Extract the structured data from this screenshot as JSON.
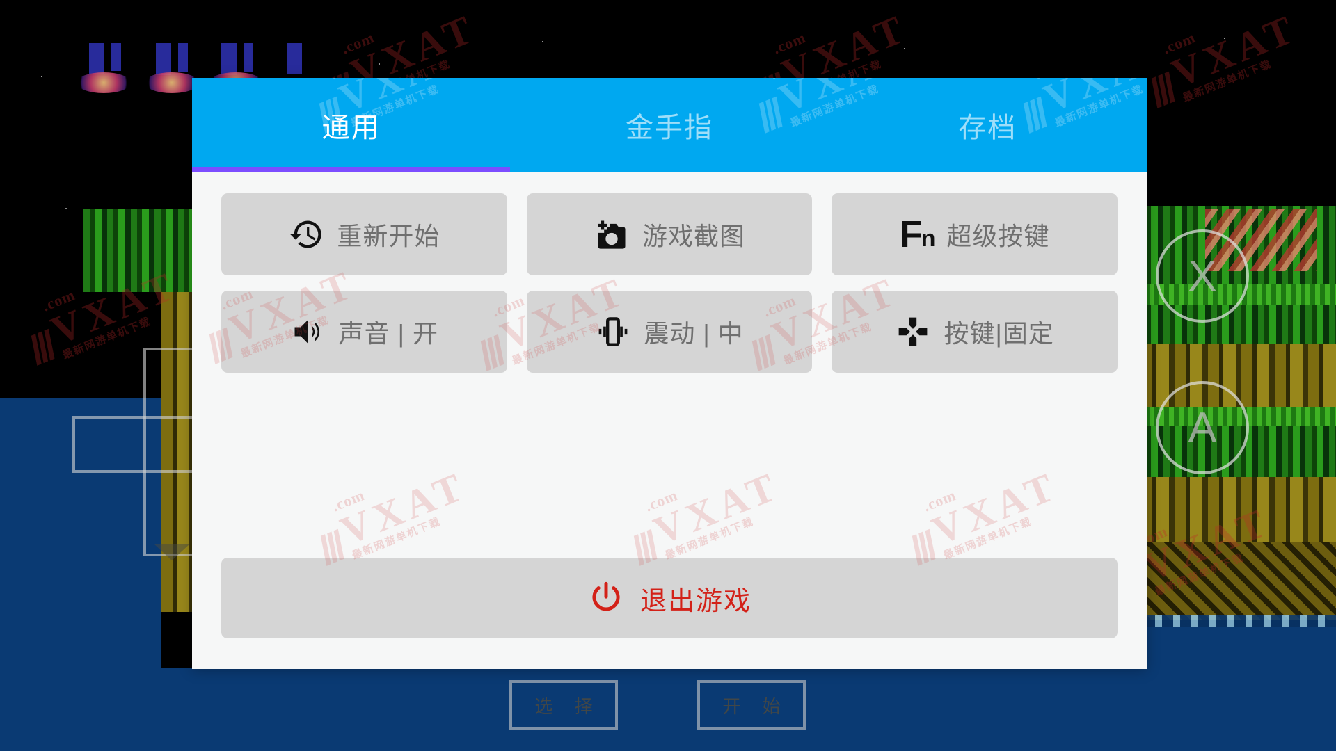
{
  "dialog": {
    "tabs": [
      {
        "id": "general",
        "label": "通用",
        "active": true
      },
      {
        "id": "cheats",
        "label": "金手指",
        "active": false
      },
      {
        "id": "saves",
        "label": "存档",
        "active": false
      }
    ],
    "options": [
      {
        "id": "restart",
        "icon": "restore-history-icon",
        "label": "重新开始"
      },
      {
        "id": "screenshot",
        "icon": "add-a-photo-icon",
        "label": "游戏截图"
      },
      {
        "id": "superkey",
        "icon": "fn-key-icon",
        "label": "超级按键",
        "icon_text": "F",
        "icon_text_sub": "n"
      },
      {
        "id": "sound",
        "icon": "volume-up-icon",
        "label": "声音 | 开"
      },
      {
        "id": "vibration",
        "icon": "vibration-icon",
        "label": "震动 | 中"
      },
      {
        "id": "buttons",
        "icon": "dpad-icon",
        "label": "按键|固定"
      }
    ],
    "exit": {
      "id": "exit-game",
      "icon": "power-icon",
      "label": "退出游戏"
    }
  },
  "gamepad": {
    "face_buttons": [
      {
        "id": "x",
        "label": "X"
      },
      {
        "id": "a",
        "label": "A"
      }
    ],
    "system_buttons": [
      {
        "id": "select",
        "label": "选 择"
      },
      {
        "id": "start",
        "label": "开 始"
      }
    ]
  },
  "watermark": {
    "slashes": "///",
    "brand": "VXAT",
    "domain": ".com",
    "subtitle": "最新网游单机下载"
  },
  "colors": {
    "tabbar_blue": "#00a8f0",
    "tab_underline_purple": "#7c4dff",
    "dialog_background": "#f6f7f7",
    "option_background": "#d5d5d5",
    "option_label": "#6f6f6f",
    "exit_red": "#d32118",
    "watermark_red": "#be2828"
  }
}
